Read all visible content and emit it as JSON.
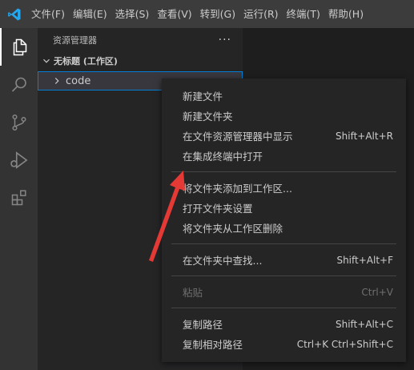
{
  "menubar": {
    "items": [
      "文件(F)",
      "编辑(E)",
      "选择(S)",
      "查看(V)",
      "转到(G)",
      "运行(R)",
      "终端(T)",
      "帮助(H)"
    ]
  },
  "sidebar": {
    "title": "资源管理器",
    "more": "···",
    "workspace": "无标题 (工作区)",
    "folder": "code"
  },
  "context_menu": {
    "groups": [
      [
        {
          "label": "新建文件",
          "shortcut": ""
        },
        {
          "label": "新建文件夹",
          "shortcut": ""
        },
        {
          "label": "在文件资源管理器中显示",
          "shortcut": "Shift+Alt+R"
        },
        {
          "label": "在集成终端中打开",
          "shortcut": ""
        }
      ],
      [
        {
          "label": "将文件夹添加到工作区...",
          "shortcut": ""
        },
        {
          "label": "打开文件夹设置",
          "shortcut": ""
        },
        {
          "label": "将文件夹从工作区删除",
          "shortcut": ""
        }
      ],
      [
        {
          "label": "在文件夹中查找...",
          "shortcut": "Shift+Alt+F"
        }
      ],
      [
        {
          "label": "粘贴",
          "shortcut": "Ctrl+V",
          "disabled": true
        }
      ],
      [
        {
          "label": "复制路径",
          "shortcut": "Shift+Alt+C"
        },
        {
          "label": "复制相对路径",
          "shortcut": "Ctrl+K Ctrl+Shift+C"
        }
      ]
    ]
  },
  "icons": {
    "app_logo": "vscode-logo-icon",
    "activity": [
      "explorer-icon",
      "search-icon",
      "source-control-icon",
      "run-debug-icon",
      "extensions-icon"
    ]
  },
  "colors": {
    "accent": "#007fd4",
    "annotation_arrow": "#e53935"
  }
}
